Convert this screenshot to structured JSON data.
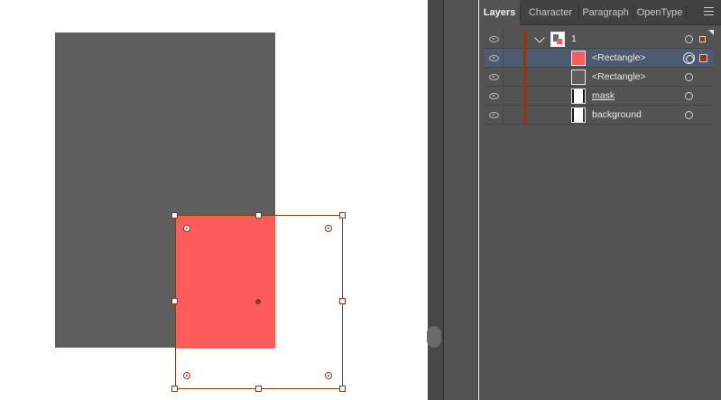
{
  "colors": {
    "artwork_gray": "#5e5e5e",
    "artwork_red": "#fe5b5b",
    "selection": "#8a3a17",
    "panel_bg": "#535353",
    "row_selected": "#4c5b70"
  },
  "panel": {
    "tabs": [
      {
        "label": "Layers",
        "active": true
      },
      {
        "label": "Character",
        "active": false
      },
      {
        "label": "Paragraph",
        "active": false
      },
      {
        "label": "OpenType",
        "active": false
      }
    ],
    "menu_icon": "hamburger-icon"
  },
  "layers": [
    {
      "name": "1",
      "kind": "layer",
      "expanded": true,
      "thumbnail": "layer-thumb",
      "visible": true
    },
    {
      "name": "<Rectangle>",
      "kind": "path",
      "thumbnail": "red-swatch",
      "visible": true,
      "selected": true
    },
    {
      "name": "<Rectangle>",
      "kind": "path",
      "thumbnail": "gray-swatch",
      "visible": true
    },
    {
      "name": "mask",
      "kind": "path",
      "thumbnail": "mask-thumb",
      "visible": true,
      "underlined": true
    },
    {
      "name": "background",
      "kind": "path",
      "thumbnail": "background-thumb",
      "visible": true
    }
  ]
}
